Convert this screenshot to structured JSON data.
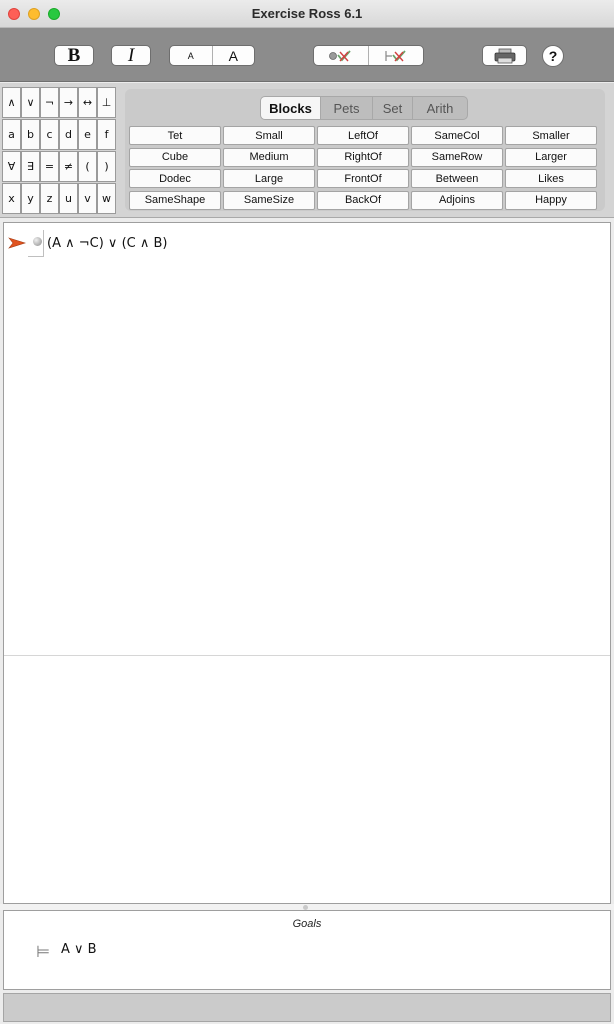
{
  "window": {
    "title": "Exercise Ross 6.1"
  },
  "toolbar": {
    "bold_label": "B",
    "italic_label": "I",
    "font_small_label": "A",
    "font_large_label": "A",
    "verify_icon": "verify-check-icon",
    "verify_all_icon": "verify-all-check-icon",
    "print_icon": "printer-icon",
    "help_label": "?"
  },
  "symbols": {
    "rows": [
      [
        "∧",
        "∨",
        "¬",
        "→",
        "↔",
        "⊥"
      ],
      [
        "a",
        "b",
        "c",
        "d",
        "e",
        "f"
      ],
      [
        "∀",
        "∃",
        "=",
        "≠",
        "(",
        ")"
      ],
      [
        "x",
        "y",
        "z",
        "u",
        "v",
        "w"
      ]
    ]
  },
  "predicates": {
    "tabs": [
      "Blocks",
      "Pets",
      "Set",
      "Arith"
    ],
    "active_tab": "Blocks",
    "rows": [
      [
        "Tet",
        "Small",
        "LeftOf",
        "SameCol",
        "Smaller"
      ],
      [
        "Cube",
        "Medium",
        "RightOf",
        "SameRow",
        "Larger"
      ],
      [
        "Dodec",
        "Large",
        "FrontOf",
        "Between",
        "Likes"
      ],
      [
        "SameShape",
        "SameSize",
        "BackOf",
        "Adjoins",
        "Happy"
      ]
    ]
  },
  "proof": {
    "premise": "(A ∧ ¬C)  ∨ (C ∧ B)"
  },
  "goals": {
    "header": "Goals",
    "goal_icon": "turnstile-icon",
    "goal_text": "A  ∨ B"
  },
  "colors": {
    "toolbar_bg": "#8c8c8c",
    "pointer_arrow": "#e0531f"
  }
}
